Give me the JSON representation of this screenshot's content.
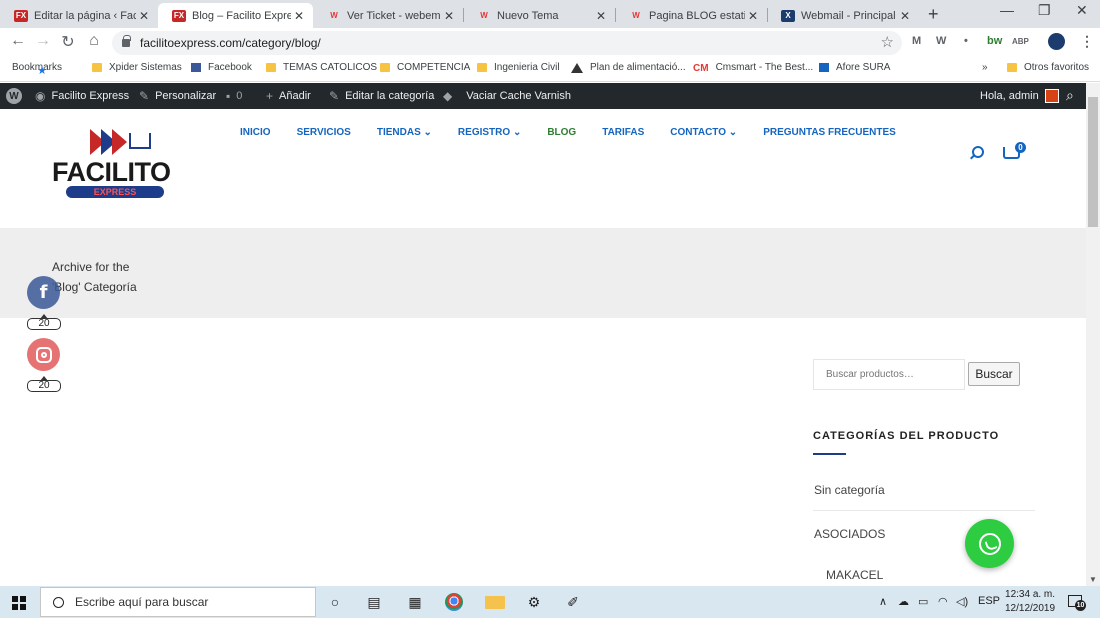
{
  "browser": {
    "tabs": [
      {
        "title": "Editar la página ‹ Facilit",
        "active": false,
        "favicon": "facilito-icon"
      },
      {
        "title": "Blog – Facilito Express",
        "active": true,
        "favicon": "facilito-icon"
      },
      {
        "title": "Ver Ticket - webempres",
        "active": false,
        "favicon": "w-icon"
      },
      {
        "title": "Nuevo Tema",
        "active": false,
        "favicon": "w-icon"
      },
      {
        "title": "Pagina BLOG estatica n",
        "active": false,
        "favicon": "w-icon"
      },
      {
        "title": "Webmail - Principal",
        "active": false,
        "favicon": "x-icon"
      }
    ],
    "url": "facilitoexpress.com/category/blog/",
    "bookmarks": [
      {
        "label": "Bookmarks",
        "icon": "star-icon"
      },
      {
        "label": "Xpider Sistemas",
        "icon": "folder-icon"
      },
      {
        "label": "Facebook",
        "icon": "facebook-icon"
      },
      {
        "label": "TEMAS CATOLICOS",
        "icon": "folder-icon"
      },
      {
        "label": "COMPETENCIA",
        "icon": "folder-icon"
      },
      {
        "label": "Ingenieria Civil",
        "icon": "folder-icon"
      },
      {
        "label": "Plan de alimentació...",
        "icon": "triangle-icon"
      },
      {
        "label": "Cmsmart - The Best...",
        "icon": "cmsmart-icon"
      },
      {
        "label": "Afore SURA",
        "icon": "square-icon"
      }
    ],
    "bookmarks_overflow": "»",
    "other_bookmarks": "Otros favoritos",
    "extensions": [
      "M",
      "W",
      "•",
      "bw",
      "ABP"
    ]
  },
  "adminbar": {
    "site_name": "Facilito Express",
    "customize": "Personalizar",
    "comments": "0",
    "add_new": "Añadir",
    "edit_category": "Editar la categoría",
    "purge_cache": "Vaciar Cache Varnish",
    "greeting": "Hola, admin"
  },
  "site": {
    "logo_word": "FACILITO",
    "logo_sub": "EXPRESS",
    "menu": [
      {
        "label": "INICIO",
        "dropdown": false,
        "current": false
      },
      {
        "label": "SERVICIOS",
        "dropdown": false,
        "current": false
      },
      {
        "label": "TIENDAS",
        "dropdown": true,
        "current": false
      },
      {
        "label": "REGISTRO",
        "dropdown": true,
        "current": false
      },
      {
        "label": "BLOG",
        "dropdown": false,
        "current": true
      },
      {
        "label": "TARIFAS",
        "dropdown": false,
        "current": false
      },
      {
        "label": "CONTACTO",
        "dropdown": true,
        "current": false
      },
      {
        "label": "PREGUNTAS FRECUENTES",
        "dropdown": false,
        "current": false
      }
    ],
    "cart_count": "0",
    "archive_title_line1": "Archive for the",
    "archive_title_line2": "'Blog' Categoría",
    "social": [
      {
        "network": "facebook",
        "count": "20"
      },
      {
        "network": "instagram",
        "count": "20"
      }
    ]
  },
  "sidebar": {
    "search_placeholder": "Buscar productos…",
    "search_button": "Buscar",
    "categories_heading": "CATEGORÍAS DEL PRODUCTO",
    "categories": [
      {
        "label": "Sin categoría",
        "level": 0
      },
      {
        "label": "ASOCIADOS",
        "level": 0
      },
      {
        "label": "MAKACEL",
        "level": 1
      }
    ]
  },
  "taskbar": {
    "search_placeholder": "Escribe aquí para buscar",
    "language": "ESP",
    "time": "12:34 a. m.",
    "date": "12/12/2019",
    "notifications": "10"
  },
  "colors": {
    "menu_link": "#1565c0",
    "menu_current": "#2e7d32",
    "adminbar": "#23282d",
    "whatsapp": "#2ecc40"
  }
}
